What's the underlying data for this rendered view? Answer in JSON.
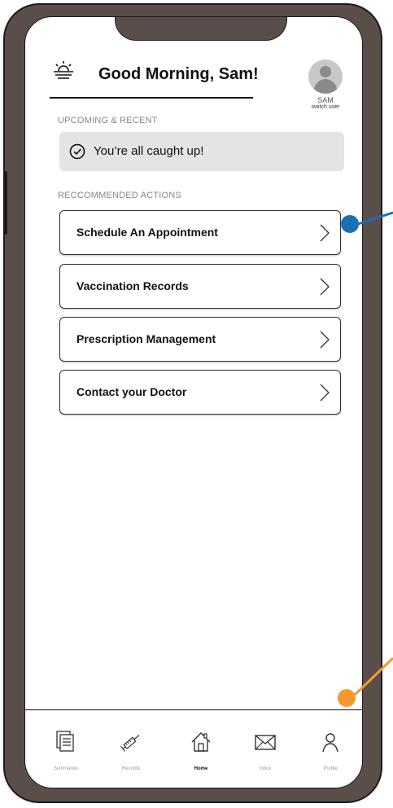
{
  "header": {
    "icon": "sunrise-icon",
    "greeting": "Good Morning, Sam!"
  },
  "user": {
    "name": "SAM",
    "switch_label": "switch user",
    "icon": "avatar-icon"
  },
  "upcoming": {
    "section_label": "UPCOMING & RECENT",
    "status_icon": "check-circle-icon",
    "status_text": "You’re all caught up!"
  },
  "recommended": {
    "section_label": "RECCOMMENDED ACTIONS",
    "items": [
      {
        "label": "Schedule An Appointment",
        "icon": "chevron-right-icon"
      },
      {
        "label": "Vaccination Records",
        "icon": "chevron-right-icon"
      },
      {
        "label": "Prescription Management",
        "icon": "chevron-right-icon"
      },
      {
        "label": "Contact your Doctor",
        "icon": "chevron-right-icon"
      }
    ]
  },
  "tabbar": {
    "items": [
      {
        "label": "Summaries",
        "icon": "document-icon",
        "active": false
      },
      {
        "label": "Records",
        "icon": "syringe-icon",
        "active": false
      },
      {
        "label": "Home",
        "icon": "home-icon",
        "active": true
      },
      {
        "label": "Inbox",
        "icon": "envelope-icon",
        "active": false
      },
      {
        "label": "Profile",
        "icon": "user-icon",
        "active": false
      }
    ]
  },
  "colors": {
    "frame": "#5a4e4b",
    "card_fill": "#e4e4e4",
    "marker_blue": "#1a6fb5",
    "marker_orange": "#f29a2e"
  }
}
